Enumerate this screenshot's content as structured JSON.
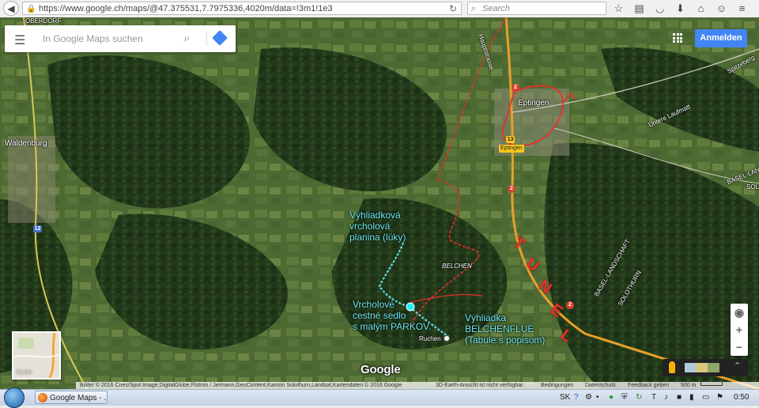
{
  "browser": {
    "url": "https://www.google.ch/maps/@47.375531,7.7975336,4020m/data=!3m1!1e3",
    "search_placeholder": "Search"
  },
  "map_ui": {
    "search_placeholder": "In Google Maps suchen",
    "sign_in_label": "Anmelden",
    "minimap_label": "Karte",
    "logo_text": "Google"
  },
  "places": {
    "eptingen": "Eptingen",
    "eptingen_exit": "Eptingen",
    "waldenburg": "Waldenburg",
    "belchen": "BELCHEN",
    "ruchen": "Ruchen",
    "hauptstrasse": "Hauptstrasse",
    "untere_laufmatt": "Untere Laufmatt",
    "basel_landschaft_1": "BASEL-LAND",
    "basel_landschaft_2": "BASEL-LANDSCHAFT",
    "solothurn": "SOLOTHURN",
    "solo_edge": "SOL",
    "oberdorf_edge": "OBERDORF",
    "spitzeberg_edge": "Spitzeberg"
  },
  "road_shields": {
    "a2_north": "2",
    "a2_mid": "2",
    "a2_south": "2",
    "route13": "13",
    "route12": "12"
  },
  "annotations": {
    "viewpoint_plateau": "Výhliadková\nvrcholová\nplanina (lúky)",
    "summit_saddle": "Vrcholové\ncestné sedlo\ns malým PARKOV.",
    "belchenflue": "Výhliadka\nBELCHENFLUE\n(Tabule s popisom)",
    "tunnel_letters": [
      "T",
      "U",
      "N",
      "E",
      "L"
    ],
    "route_color": "#e8302a",
    "trail_color": "#5fe0e6"
  },
  "footer": {
    "imagery": "Bilder © 2016 Cnes/Spot Image,DigitalGlobe,Flotron / Jermann,GeoContent,Kanton Solothurn,Landsat,Kartendaten © 2016 Google",
    "earth_view": "3D-Earth-Ansicht ist nicht verfügbar.",
    "terms": "Bedingungen",
    "privacy": "Datenschutz",
    "feedback": "Feedback geben",
    "scale": "500 m"
  },
  "taskbar": {
    "window_title": "Google Maps - ...",
    "language": "SK",
    "clock": "0:50"
  }
}
